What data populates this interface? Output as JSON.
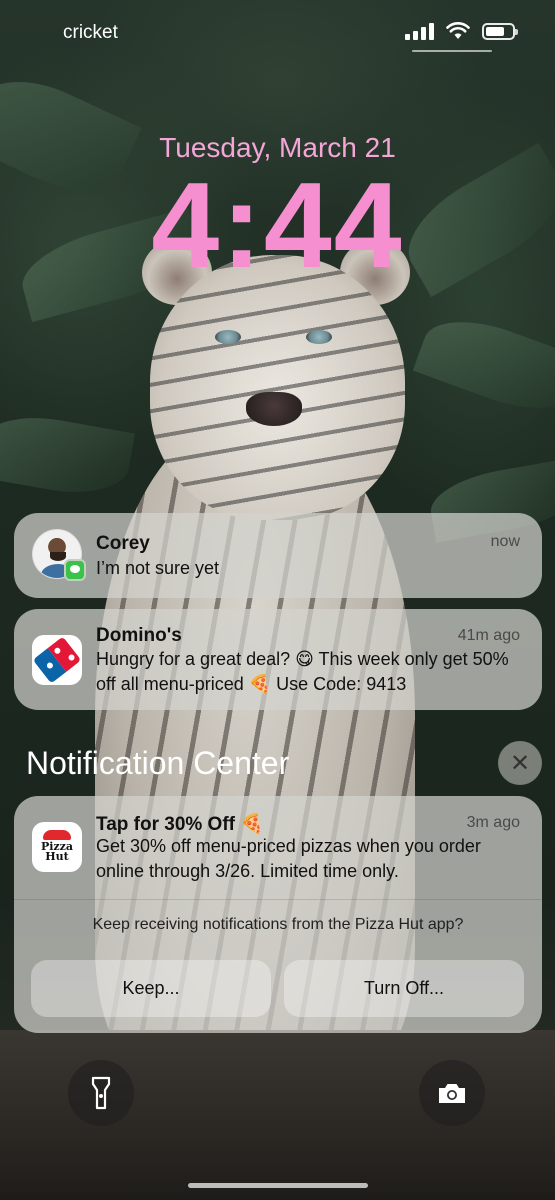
{
  "status_bar": {
    "carrier": "cricket",
    "signal_bars": 4,
    "battery_level_percent": 70
  },
  "lock_screen": {
    "date": "Tuesday, March 21",
    "time": "4:44",
    "colors": {
      "date": "#f4a6d7",
      "time": "#f58fd0"
    }
  },
  "notifications": [
    {
      "app": "Messages",
      "icon": "contact-avatar-icon",
      "title": "Corey",
      "timestamp": "now",
      "body": "I’m not sure yet"
    },
    {
      "app": "Domino's",
      "icon": "dominos-logo-icon",
      "title": "Domino's",
      "timestamp": "41m ago",
      "body": "Hungry for a great deal? 😋 This week only get 50% off all menu-priced 🍕 Use Code: 9413"
    }
  ],
  "notification_center": {
    "title": "Notification Center",
    "close_icon": "close-icon",
    "items": [
      {
        "app": "Pizza Hut",
        "icon": "pizza-hut-logo-icon",
        "logo_text": "Pizza Hut",
        "title": "Tap for 30% Off 🍕",
        "timestamp": "3m ago",
        "body": "Get 30% off menu-priced pizzas when you order online through 3/26. Limited time only.",
        "prompt": "Keep receiving notifications from the Pizza Hut app?",
        "keep_label": "Keep...",
        "turn_off_label": "Turn Off..."
      }
    ]
  },
  "quick_actions": {
    "left_icon": "flashlight-icon",
    "right_icon": "camera-icon"
  }
}
